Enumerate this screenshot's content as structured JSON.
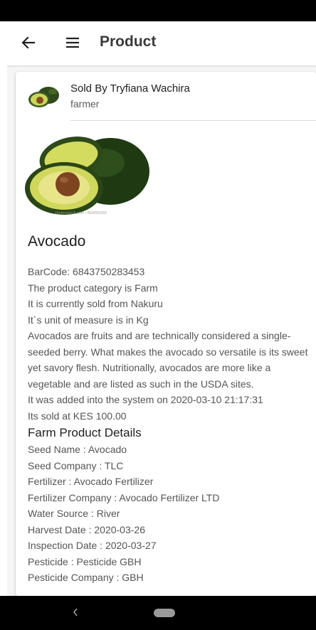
{
  "app_bar": {
    "title": "Product",
    "back_icon": "arrow-left-icon",
    "menu_icon": "hamburger-menu-icon"
  },
  "seller": {
    "name": "Sold By Tryfiana Wachira",
    "role": "farmer"
  },
  "product": {
    "image_caption": "shutterstock.com • 664291903",
    "name": "Avocado",
    "barcode": "BarCode: 6843750283453",
    "category": "The product category is Farm",
    "location": "It is currently sold from Nakuru",
    "unit": "It`s unit of measure is in Kg",
    "description": "Avocados are fruits and are technically considered a single-seeded berry. What makes the avocado so versatile is its sweet yet savory flesh. Nutritionally, avocados are more like a vegetable and are listed as such in the USDA sites.",
    "added": "It was added into the system on 2020-03-10 21:17:31",
    "price": "Its sold at KES 100.00"
  },
  "farm_details": {
    "title": "Farm Product Details",
    "seed_name": "Seed Name : Avocado",
    "seed_company": "Seed Company : TLC",
    "fertilizer": "Fertilizer : Avocado Fertilizer",
    "fertilizer_company": "Fertilizer Company : Avocado Fertilizer LTD",
    "water_source": "Water Source : River",
    "harvest_date": "Harvest Date : 2020-03-26",
    "inspection_date": "Inspection Date : 2020-03-27",
    "pesticide": "Pesticide : Pesticide GBH",
    "pesticide_company": "Pesticide Company : GBH"
  },
  "colors": {
    "status_bar": "#000000",
    "nav_bar": "#000000",
    "avocado_skin": "#2f4a1c",
    "avocado_flesh": "#c9d65a",
    "avocado_pit": "#8a4a22"
  }
}
